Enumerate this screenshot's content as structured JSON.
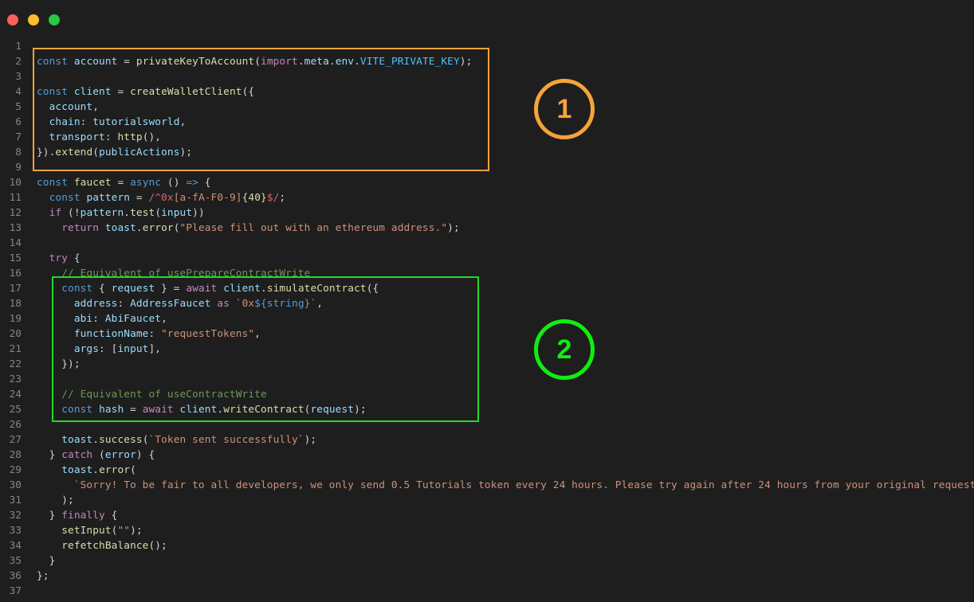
{
  "window": {
    "controls": [
      "close",
      "minimize",
      "maximize"
    ]
  },
  "annotations": {
    "box1_label": "1",
    "box2_label": "2",
    "box1_color": "#f5a33b",
    "box2_color": "#22d92a"
  },
  "code": {
    "lines": [
      {
        "n": "1",
        "tokens": []
      },
      {
        "n": "2",
        "tokens": [
          [
            "kw-blue",
            "const"
          ],
          [
            "plain",
            " "
          ],
          [
            "var",
            "account"
          ],
          [
            "plain",
            " = "
          ],
          [
            "fn",
            "privateKeyToAccount"
          ],
          [
            "plain",
            "("
          ],
          [
            "kw-purple",
            "import"
          ],
          [
            "plain",
            "."
          ],
          [
            "var",
            "meta"
          ],
          [
            "plain",
            "."
          ],
          [
            "var",
            "env"
          ],
          [
            "plain",
            "."
          ],
          [
            "const",
            "VITE_PRIVATE_KEY"
          ],
          [
            "plain",
            ");"
          ]
        ]
      },
      {
        "n": "3",
        "tokens": []
      },
      {
        "n": "4",
        "tokens": [
          [
            "kw-blue",
            "const"
          ],
          [
            "plain",
            " "
          ],
          [
            "var",
            "client"
          ],
          [
            "plain",
            " = "
          ],
          [
            "fn",
            "createWalletClient"
          ],
          [
            "plain",
            "({"
          ]
        ]
      },
      {
        "n": "5",
        "tokens": [
          [
            "plain",
            "  "
          ],
          [
            "var",
            "account"
          ],
          [
            "plain",
            ","
          ]
        ]
      },
      {
        "n": "6",
        "tokens": [
          [
            "plain",
            "  "
          ],
          [
            "var",
            "chain"
          ],
          [
            "plain",
            ": "
          ],
          [
            "var",
            "tutorialsworld"
          ],
          [
            "plain",
            ","
          ]
        ]
      },
      {
        "n": "7",
        "tokens": [
          [
            "plain",
            "  "
          ],
          [
            "var",
            "transport"
          ],
          [
            "plain",
            ": "
          ],
          [
            "fn",
            "http"
          ],
          [
            "plain",
            "(),"
          ]
        ]
      },
      {
        "n": "8",
        "tokens": [
          [
            "plain",
            "})."
          ],
          [
            "fn",
            "extend"
          ],
          [
            "plain",
            "("
          ],
          [
            "var",
            "publicActions"
          ],
          [
            "plain",
            ");"
          ]
        ]
      },
      {
        "n": "9",
        "tokens": []
      },
      {
        "n": "10",
        "tokens": [
          [
            "kw-blue",
            "const"
          ],
          [
            "plain",
            " "
          ],
          [
            "fn",
            "faucet"
          ],
          [
            "plain",
            " = "
          ],
          [
            "kw-blue",
            "async"
          ],
          [
            "plain",
            " () "
          ],
          [
            "kw-blue",
            "=>"
          ],
          [
            "plain",
            " {"
          ]
        ]
      },
      {
        "n": "11",
        "tokens": [
          [
            "plain",
            "  "
          ],
          [
            "kw-blue",
            "const"
          ],
          [
            "plain",
            " "
          ],
          [
            "var",
            "pattern"
          ],
          [
            "plain",
            " = "
          ],
          [
            "rx",
            "/^0x"
          ],
          [
            "str",
            "[a-fA-F0-9]"
          ],
          [
            "fn",
            "{40}"
          ],
          [
            "rx",
            "$/"
          ],
          [
            "plain",
            ";"
          ]
        ]
      },
      {
        "n": "12",
        "tokens": [
          [
            "plain",
            "  "
          ],
          [
            "kw-purple",
            "if"
          ],
          [
            "plain",
            " (!"
          ],
          [
            "var",
            "pattern"
          ],
          [
            "plain",
            "."
          ],
          [
            "fn",
            "test"
          ],
          [
            "plain",
            "("
          ],
          [
            "var",
            "input"
          ],
          [
            "plain",
            "))"
          ]
        ]
      },
      {
        "n": "13",
        "tokens": [
          [
            "plain",
            "    "
          ],
          [
            "kw-purple",
            "return"
          ],
          [
            "plain",
            " "
          ],
          [
            "var",
            "toast"
          ],
          [
            "plain",
            "."
          ],
          [
            "fn",
            "error"
          ],
          [
            "plain",
            "("
          ],
          [
            "str",
            "\"Please fill out with an ethereum address.\""
          ],
          [
            "plain",
            ");"
          ]
        ]
      },
      {
        "n": "14",
        "tokens": []
      },
      {
        "n": "15",
        "tokens": [
          [
            "plain",
            "  "
          ],
          [
            "kw-purple",
            "try"
          ],
          [
            "plain",
            " {"
          ]
        ]
      },
      {
        "n": "16",
        "tokens": [
          [
            "plain",
            "    "
          ],
          [
            "cm",
            "// Equivalent of usePrepareContractWrite"
          ]
        ]
      },
      {
        "n": "17",
        "tokens": [
          [
            "plain",
            "    "
          ],
          [
            "kw-blue",
            "const"
          ],
          [
            "plain",
            " { "
          ],
          [
            "var",
            "request"
          ],
          [
            "plain",
            " } = "
          ],
          [
            "kw-purple",
            "await"
          ],
          [
            "plain",
            " "
          ],
          [
            "var",
            "client"
          ],
          [
            "plain",
            "."
          ],
          [
            "fn",
            "simulateContract"
          ],
          [
            "plain",
            "({"
          ]
        ]
      },
      {
        "n": "18",
        "tokens": [
          [
            "plain",
            "      "
          ],
          [
            "var",
            "address"
          ],
          [
            "plain",
            ": "
          ],
          [
            "var",
            "AddressFaucet"
          ],
          [
            "plain",
            " "
          ],
          [
            "kw-purple",
            "as"
          ],
          [
            "plain",
            " "
          ],
          [
            "str",
            "`0x"
          ],
          [
            "tpl",
            "${string}"
          ],
          [
            "str",
            "`"
          ],
          [
            "plain",
            ","
          ]
        ]
      },
      {
        "n": "19",
        "tokens": [
          [
            "plain",
            "      "
          ],
          [
            "var",
            "abi"
          ],
          [
            "plain",
            ": "
          ],
          [
            "var",
            "AbiFaucet"
          ],
          [
            "plain",
            ","
          ]
        ]
      },
      {
        "n": "20",
        "tokens": [
          [
            "plain",
            "      "
          ],
          [
            "var",
            "functionName"
          ],
          [
            "plain",
            ": "
          ],
          [
            "str",
            "\"requestTokens\""
          ],
          [
            "plain",
            ","
          ]
        ]
      },
      {
        "n": "21",
        "tokens": [
          [
            "plain",
            "      "
          ],
          [
            "var",
            "args"
          ],
          [
            "plain",
            ": ["
          ],
          [
            "var",
            "input"
          ],
          [
            "plain",
            "],"
          ]
        ]
      },
      {
        "n": "22",
        "tokens": [
          [
            "plain",
            "    });"
          ]
        ]
      },
      {
        "n": "23",
        "tokens": []
      },
      {
        "n": "24",
        "tokens": [
          [
            "plain",
            "    "
          ],
          [
            "cm",
            "// Equivalent of useContractWrite"
          ]
        ]
      },
      {
        "n": "25",
        "tokens": [
          [
            "plain",
            "    "
          ],
          [
            "kw-blue",
            "const"
          ],
          [
            "plain",
            " "
          ],
          [
            "var",
            "hash"
          ],
          [
            "plain",
            " = "
          ],
          [
            "kw-purple",
            "await"
          ],
          [
            "plain",
            " "
          ],
          [
            "var",
            "client"
          ],
          [
            "plain",
            "."
          ],
          [
            "fn",
            "writeContract"
          ],
          [
            "plain",
            "("
          ],
          [
            "var",
            "request"
          ],
          [
            "plain",
            ");"
          ]
        ]
      },
      {
        "n": "26",
        "tokens": []
      },
      {
        "n": "27",
        "tokens": [
          [
            "plain",
            "    "
          ],
          [
            "var",
            "toast"
          ],
          [
            "plain",
            "."
          ],
          [
            "fn",
            "success"
          ],
          [
            "plain",
            "("
          ],
          [
            "str",
            "`Token sent successfully`"
          ],
          [
            "plain",
            ");"
          ]
        ]
      },
      {
        "n": "28",
        "tokens": [
          [
            "plain",
            "  } "
          ],
          [
            "kw-purple",
            "catch"
          ],
          [
            "plain",
            " ("
          ],
          [
            "var",
            "error"
          ],
          [
            "plain",
            ") {"
          ]
        ]
      },
      {
        "n": "29",
        "tokens": [
          [
            "plain",
            "    "
          ],
          [
            "var",
            "toast"
          ],
          [
            "plain",
            "."
          ],
          [
            "fn",
            "error"
          ],
          [
            "plain",
            "("
          ]
        ]
      },
      {
        "n": "30",
        "tokens": [
          [
            "plain",
            "      "
          ],
          [
            "str",
            "`Sorry! To be fair to all developers, we only send 0.5 Tutorials token every 24 hours. Please try again after 24 hours from your original request.`"
          ]
        ]
      },
      {
        "n": "31",
        "tokens": [
          [
            "plain",
            "    );"
          ]
        ]
      },
      {
        "n": "32",
        "tokens": [
          [
            "plain",
            "  } "
          ],
          [
            "kw-purple",
            "finally"
          ],
          [
            "plain",
            " {"
          ]
        ]
      },
      {
        "n": "33",
        "tokens": [
          [
            "plain",
            "    "
          ],
          [
            "fn",
            "setInput"
          ],
          [
            "plain",
            "("
          ],
          [
            "str",
            "\"\""
          ],
          [
            "plain",
            ");"
          ]
        ]
      },
      {
        "n": "34",
        "tokens": [
          [
            "plain",
            "    "
          ],
          [
            "fn",
            "refetchBalance"
          ],
          [
            "plain",
            "();"
          ]
        ]
      },
      {
        "n": "35",
        "tokens": [
          [
            "plain",
            "  }"
          ]
        ]
      },
      {
        "n": "36",
        "tokens": [
          [
            "plain",
            "};"
          ]
        ]
      },
      {
        "n": "37",
        "tokens": []
      }
    ]
  }
}
